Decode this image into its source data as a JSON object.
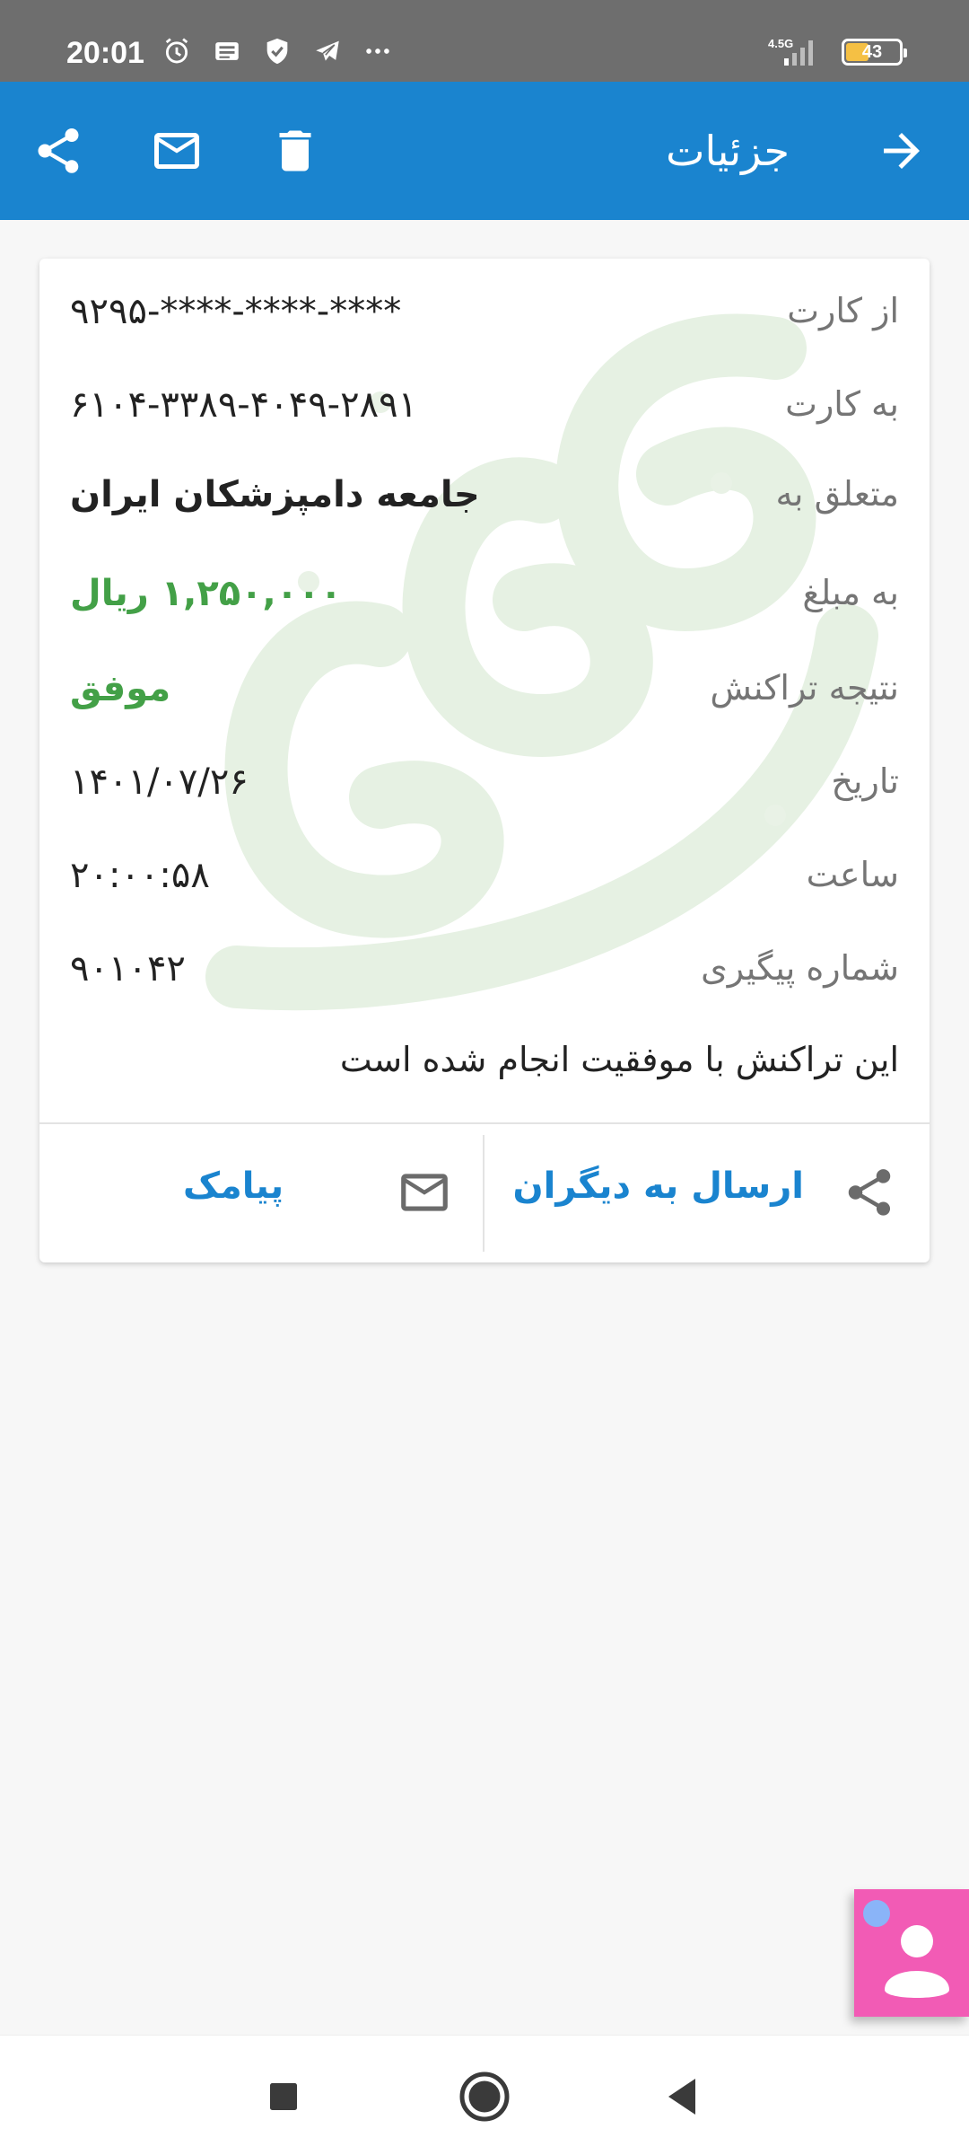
{
  "status_bar": {
    "time": "20:01",
    "network": "4.5G",
    "battery": "43",
    "battery_level": 0.43,
    "icons": [
      "alarm-icon",
      "news-icon",
      "shield-check-icon",
      "telegram-icon",
      "more-dots-icon",
      "signal-icon"
    ]
  },
  "app_bar": {
    "title": "جزئیات",
    "icons": [
      "back-arrow-icon",
      "delete-icon",
      "mail-icon",
      "share-icon"
    ],
    "color": "#1a84cf"
  },
  "details": [
    {
      "label": "از کارت",
      "value": "****-****-****-۹۲۹۵",
      "style": "normal"
    },
    {
      "label": "به کارت",
      "value": "۶۱۰۴-۳۳۸۹-۴۰۴۹-۲۸۹۱",
      "style": "normal"
    },
    {
      "label": "متعلق به",
      "value": "جامعه دامپزشکان ایران",
      "style": "bold"
    },
    {
      "label": "به مبلغ",
      "value": "۱,۲۵۰,۰۰۰ ریال",
      "style": "green"
    },
    {
      "label": "نتیجه تراکنش",
      "value": "موفق",
      "style": "green"
    },
    {
      "label": "تاریخ",
      "value": "۱۴۰۱/۰۷/۲۶",
      "style": "normal"
    },
    {
      "label": "ساعت",
      "value": "۲۰:۰۰:۵۸",
      "style": "normal"
    },
    {
      "label": "شماره پیگیری",
      "value": "۹۰۱۰۴۲",
      "style": "normal"
    }
  ],
  "message": "این تراکنش با موفقیت انجام شده است",
  "actions": {
    "send_to_others": "ارسال به دیگران",
    "sms": "پیامک"
  },
  "colors": {
    "success": "#43a047",
    "accent": "#1a84cf",
    "float_button": "#f25bb5"
  },
  "nav_bar": {
    "icons": [
      "recent-apps-icon",
      "home-icon",
      "back-icon"
    ]
  }
}
